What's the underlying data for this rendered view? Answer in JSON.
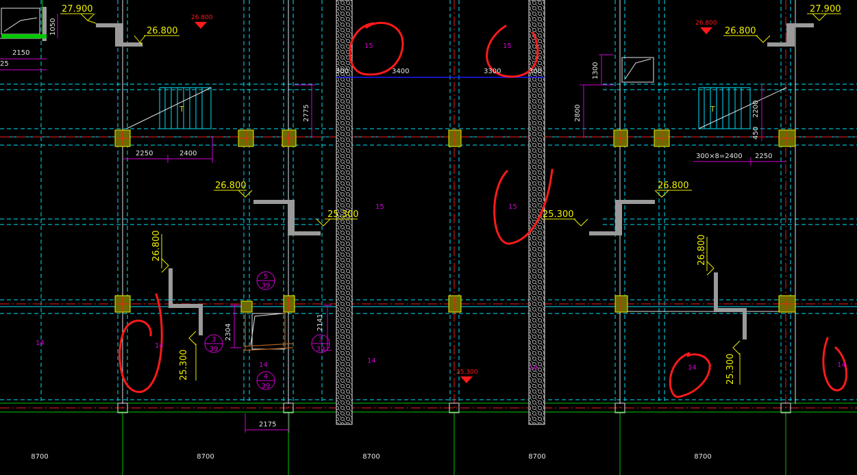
{
  "colors": {
    "background": "#000000",
    "grid": "#00e5ff",
    "wall": "#e6e6e6",
    "dimension": "#d400d4",
    "elevation": "#f0f000",
    "markup": "#ff1a1a",
    "axis": "#00c800",
    "hatch": "#cfcfcf",
    "column": "#e6e600",
    "beam": "#1a1aff"
  },
  "elevations": {
    "top_left": "27.900",
    "top_right": "27.900",
    "upper_left": "26.800",
    "upper_right": "26.800",
    "mid_left": "26.800",
    "mid_right": "26.800",
    "landing_left": "25.300",
    "landing_right": "25.300",
    "vert_left_top": "26.800",
    "vert_left_bottom": "25.300",
    "vert_right_top": "26.800",
    "vert_right_bottom": "25.300",
    "red_top_left": "26.800",
    "red_top_right": "26.800",
    "red_bottom": "25.300"
  },
  "dimensions": {
    "d1050": "1050",
    "d2150": "2150",
    "d25": "25",
    "d2250_left": "2250",
    "d2400_left": "2400",
    "d2775": "2775",
    "d_top_300a": "300",
    "d3400": "3400",
    "d3300": "3300",
    "d_top_300b": "300",
    "d1300": "1300",
    "d2800": "2800",
    "d2200": "2200",
    "d450": "450",
    "d_tread": "300×8=2400",
    "d2250_right": "2250",
    "d2304": "2304",
    "d2141": "2141",
    "d2175": "2175"
  },
  "slab_labels": {
    "s15_a": "15",
    "s15_b": "15",
    "s15_c": "15",
    "s15_d": "15",
    "s14_a": "14",
    "s14_b": "14",
    "s14_c": "14",
    "s14_d": "14",
    "s14_e": "14",
    "s14_f": "14",
    "s14_g": "14"
  },
  "detail_marks": [
    {
      "top": "5",
      "bottom": "39"
    },
    {
      "top": "3",
      "bottom": "39"
    },
    {
      "top": "3",
      "bottom": "39"
    },
    {
      "top": "4",
      "bottom": "39"
    }
  ],
  "stair_labels": {
    "left": "T",
    "right": "T"
  },
  "axis_spans": [
    "8700",
    "8700",
    "8700",
    "8700",
    "8700"
  ]
}
